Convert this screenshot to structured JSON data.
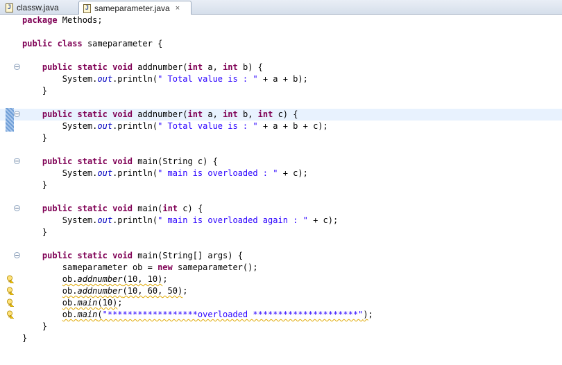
{
  "tabs": [
    {
      "label": "classw.java",
      "active": false
    },
    {
      "label": "sameparameter.java",
      "active": true,
      "close_glyph": "×"
    }
  ],
  "editor": {
    "current_line": 9,
    "lines": [
      {
        "segments": [
          {
            "t": "kw",
            "v": "package"
          },
          {
            "t": "plain",
            "v": " Methods;"
          }
        ]
      },
      {
        "segments": []
      },
      {
        "segments": [
          {
            "t": "kw",
            "v": "public"
          },
          {
            "t": "plain",
            "v": " "
          },
          {
            "t": "kw",
            "v": "class"
          },
          {
            "t": "plain",
            "v": " sameparameter {"
          }
        ]
      },
      {
        "segments": []
      },
      {
        "fold": true,
        "segments": [
          {
            "t": "plain",
            "v": "    "
          },
          {
            "t": "kw",
            "v": "public"
          },
          {
            "t": "plain",
            "v": " "
          },
          {
            "t": "kw",
            "v": "static"
          },
          {
            "t": "plain",
            "v": " "
          },
          {
            "t": "kw",
            "v": "void"
          },
          {
            "t": "plain",
            "v": " addnumber("
          },
          {
            "t": "kw",
            "v": "int"
          },
          {
            "t": "plain",
            "v": " a, "
          },
          {
            "t": "kw",
            "v": "int"
          },
          {
            "t": "plain",
            "v": " b) {"
          }
        ]
      },
      {
        "segments": [
          {
            "t": "plain",
            "v": "        System."
          },
          {
            "t": "it",
            "v": "out"
          },
          {
            "t": "plain",
            "v": ".println("
          },
          {
            "t": "str",
            "v": "\" Total value is : \""
          },
          {
            "t": "plain",
            "v": " + a + b);"
          }
        ]
      },
      {
        "segments": [
          {
            "t": "plain",
            "v": "    }"
          }
        ]
      },
      {
        "segments": []
      },
      {
        "fold": true,
        "marker": true,
        "segments": [
          {
            "t": "plain",
            "v": "    "
          },
          {
            "t": "kw",
            "v": "public"
          },
          {
            "t": "plain",
            "v": " "
          },
          {
            "t": "kw",
            "v": "static"
          },
          {
            "t": "plain",
            "v": " "
          },
          {
            "t": "kw",
            "v": "void"
          },
          {
            "t": "plain",
            "v": " addnumber("
          },
          {
            "t": "kw",
            "v": "int"
          },
          {
            "t": "plain",
            "v": " a, "
          },
          {
            "t": "kw",
            "v": "int"
          },
          {
            "t": "plain",
            "v": " b, "
          },
          {
            "t": "kw",
            "v": "int"
          },
          {
            "t": "plain",
            "v": " c) {"
          }
        ]
      },
      {
        "segments": [
          {
            "t": "plain",
            "v": "        System."
          },
          {
            "t": "it",
            "v": "out"
          },
          {
            "t": "plain",
            "v": ".println("
          },
          {
            "t": "str",
            "v": "\" Total value is : \""
          },
          {
            "t": "plain",
            "v": " + a + b + c);"
          }
        ]
      },
      {
        "segments": [
          {
            "t": "plain",
            "v": "    }"
          }
        ]
      },
      {
        "segments": []
      },
      {
        "fold": true,
        "segments": [
          {
            "t": "plain",
            "v": "    "
          },
          {
            "t": "kw",
            "v": "public"
          },
          {
            "t": "plain",
            "v": " "
          },
          {
            "t": "kw",
            "v": "static"
          },
          {
            "t": "plain",
            "v": " "
          },
          {
            "t": "kw",
            "v": "void"
          },
          {
            "t": "plain",
            "v": " main(String c) {"
          }
        ]
      },
      {
        "segments": [
          {
            "t": "plain",
            "v": "        System."
          },
          {
            "t": "it",
            "v": "out"
          },
          {
            "t": "plain",
            "v": ".println("
          },
          {
            "t": "str",
            "v": "\" main is overloaded : \""
          },
          {
            "t": "plain",
            "v": " + c);"
          }
        ]
      },
      {
        "segments": [
          {
            "t": "plain",
            "v": "    }"
          }
        ]
      },
      {
        "segments": []
      },
      {
        "fold": true,
        "segments": [
          {
            "t": "plain",
            "v": "    "
          },
          {
            "t": "kw",
            "v": "public"
          },
          {
            "t": "plain",
            "v": " "
          },
          {
            "t": "kw",
            "v": "static"
          },
          {
            "t": "plain",
            "v": " "
          },
          {
            "t": "kw",
            "v": "void"
          },
          {
            "t": "plain",
            "v": " main("
          },
          {
            "t": "kw",
            "v": "int"
          },
          {
            "t": "plain",
            "v": " c) {"
          }
        ]
      },
      {
        "segments": [
          {
            "t": "plain",
            "v": "        System."
          },
          {
            "t": "it",
            "v": "out"
          },
          {
            "t": "plain",
            "v": ".println("
          },
          {
            "t": "str",
            "v": "\" main is overloaded again : \""
          },
          {
            "t": "plain",
            "v": " + c);"
          }
        ]
      },
      {
        "segments": [
          {
            "t": "plain",
            "v": "    }"
          }
        ]
      },
      {
        "segments": []
      },
      {
        "fold": true,
        "segments": [
          {
            "t": "plain",
            "v": "    "
          },
          {
            "t": "kw",
            "v": "public"
          },
          {
            "t": "plain",
            "v": " "
          },
          {
            "t": "kw",
            "v": "static"
          },
          {
            "t": "plain",
            "v": " "
          },
          {
            "t": "kw",
            "v": "void"
          },
          {
            "t": "plain",
            "v": " main(String[] args) {"
          }
        ]
      },
      {
        "segments": [
          {
            "t": "plain",
            "v": "        sameparameter ob = "
          },
          {
            "t": "kw",
            "v": "new"
          },
          {
            "t": "plain",
            "v": " sameparameter();"
          }
        ]
      },
      {
        "warning": true,
        "segments": [
          {
            "t": "plain",
            "v": "        "
          },
          {
            "t": "sq",
            "v": "ob."
          },
          {
            "t": "sqmi",
            "v": "addnumber"
          },
          {
            "t": "sq",
            "v": "(10, 10)"
          },
          {
            "t": "plain",
            "v": ";"
          }
        ]
      },
      {
        "warning": true,
        "segments": [
          {
            "t": "plain",
            "v": "        "
          },
          {
            "t": "sq",
            "v": "ob."
          },
          {
            "t": "sqmi",
            "v": "addnumber"
          },
          {
            "t": "sq",
            "v": "(10, 60, 50)"
          },
          {
            "t": "plain",
            "v": ";"
          }
        ]
      },
      {
        "warning": true,
        "segments": [
          {
            "t": "plain",
            "v": "        "
          },
          {
            "t": "sq",
            "v": "ob."
          },
          {
            "t": "sqmi",
            "v": "main"
          },
          {
            "t": "sq",
            "v": "(10)"
          },
          {
            "t": "plain",
            "v": ";"
          }
        ]
      },
      {
        "warning": true,
        "segments": [
          {
            "t": "plain",
            "v": "        "
          },
          {
            "t": "sq",
            "v": "ob."
          },
          {
            "t": "sqmi",
            "v": "main"
          },
          {
            "t": "sq",
            "v": "("
          },
          {
            "t": "sqstr",
            "v": "\"******************overloaded *********************\""
          },
          {
            "t": "sq",
            "v": ")"
          },
          {
            "t": "plain",
            "v": ";"
          }
        ]
      },
      {
        "segments": [
          {
            "t": "plain",
            "v": "    }"
          }
        ]
      },
      {
        "segments": [
          {
            "t": "plain",
            "v": "}"
          }
        ]
      }
    ]
  },
  "icons": {
    "file": "java-file-icon",
    "fold": "fold-collapse-icon",
    "warning": "warning-lightbulb-icon",
    "close": "close-icon"
  },
  "colors": {
    "keyword": "#7f0055",
    "string": "#2a00ff",
    "field": "#0000c0",
    "current_line": "#e8f2fe",
    "warning_squiggle": "#e0a800"
  }
}
